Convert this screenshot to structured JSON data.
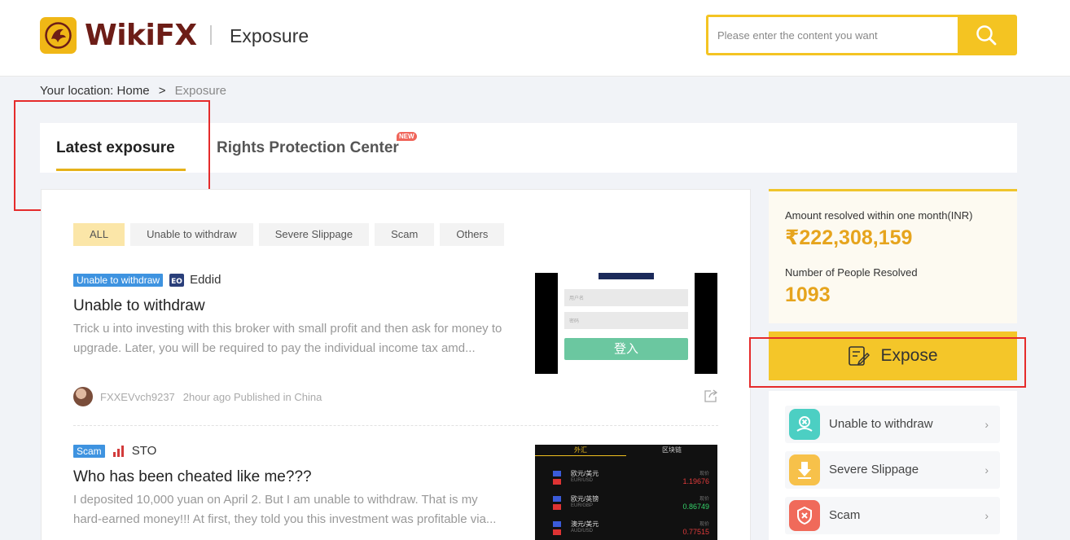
{
  "header": {
    "brand": "WikiFX",
    "section_title": "Exposure",
    "search_placeholder": "Please enter the content you want"
  },
  "breadcrumb": {
    "prefix": "Your location:",
    "home": "Home",
    "separator": ">",
    "current": "Exposure"
  },
  "tabs": {
    "latest": "Latest exposure",
    "rights": "Rights Protection Center",
    "new_badge": "NEW"
  },
  "filters": [
    "ALL",
    "Unable to withdraw",
    "Severe Slippage",
    "Scam",
    "Others"
  ],
  "items": [
    {
      "tag": "Unable to withdraw",
      "broker": "Eddid",
      "broker_icon": "eddid-logo-icon",
      "title": "Unable to withdraw",
      "desc": "Trick u into investing with this broker with small profit and then ask for money to upgrade. Later, you will be required to pay the individual income tax amd...",
      "author": "FXXEVvch9237",
      "meta": "2hour ago Published in China",
      "thumb": {
        "field1": "用户名",
        "field2": "密码",
        "button": "登入"
      }
    },
    {
      "tag": "Scam",
      "broker": "STO",
      "broker_icon": "sto-logo-icon",
      "title": "Who has been cheated like me???",
      "desc": "I deposited 10,000 yuan on April 2. But I am unable to withdraw. That is my hard-earned money!!! At first, they told you this investment was profitable via...",
      "thumb": {
        "tab1": "外汇",
        "tab2": "区块链",
        "price_label": "现价",
        "rows": [
          {
            "pair": "欧元/美元",
            "code": "EUR/USD",
            "price": "1.19676",
            "color": "#e03b3b"
          },
          {
            "pair": "欧元/英镑",
            "code": "EUR/GBP",
            "price": "0.86749",
            "color": "#35d46b"
          },
          {
            "pair": "澳元/美元",
            "code": "AUD/USD",
            "price": "0.77515",
            "color": "#e03b3b"
          }
        ]
      }
    }
  ],
  "stats": {
    "amount_label": "Amount resolved within one month(INR)",
    "amount_value": "₹222,308,159",
    "people_label": "Number of People Resolved",
    "people_value": "1093"
  },
  "expose_button": "Expose",
  "categories": [
    {
      "label": "Unable to withdraw",
      "icon": "withdraw-icon",
      "color": "#4ccfc3"
    },
    {
      "label": "Severe Slippage",
      "icon": "slippage-icon",
      "color": "#f7c14a"
    },
    {
      "label": "Scam",
      "icon": "scam-icon",
      "color": "#f06a5a"
    }
  ],
  "colors": {
    "accent": "#f4c422",
    "brand": "#6d1d17",
    "stat_value": "#e6a41d",
    "tag_blue": "#3e93e0",
    "annotation_red": "#e52b2b"
  }
}
